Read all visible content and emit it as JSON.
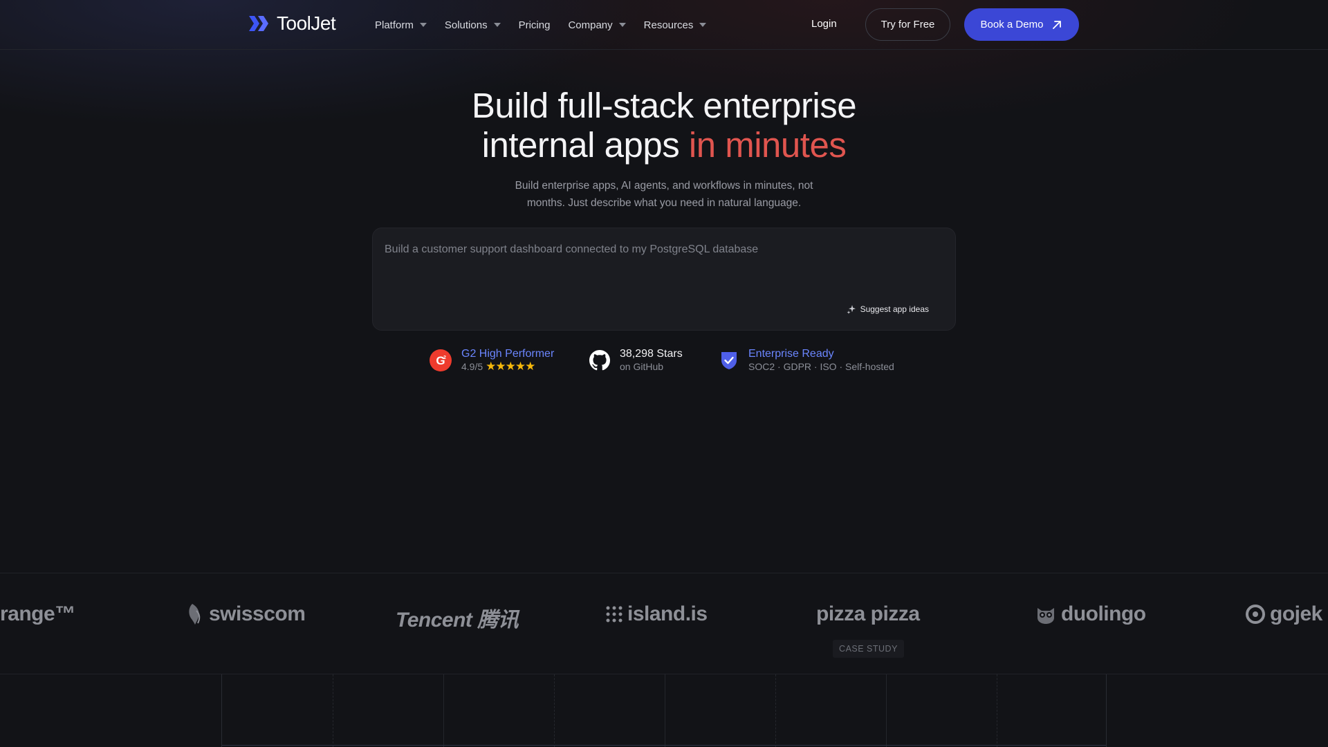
{
  "nav": {
    "brand": "ToolJet",
    "items": [
      {
        "label": "Platform",
        "dropdown": true
      },
      {
        "label": "Solutions",
        "dropdown": true
      },
      {
        "label": "Pricing",
        "dropdown": false
      },
      {
        "label": "Company",
        "dropdown": true
      },
      {
        "label": "Resources",
        "dropdown": true
      }
    ],
    "login": "Login",
    "try_free": "Try for Free",
    "book_demo": "Book a Demo"
  },
  "hero": {
    "title_line1": "Build full-stack enterprise",
    "title_line2_plain": "internal apps ",
    "title_line2_accent": "in minutes",
    "subtitle_line1": "Build enterprise apps, AI agents, and workflows in minutes, not",
    "subtitle_line2": "months. Just describe what you need in natural language."
  },
  "prompt": {
    "placeholder": "Build a customer support dashboard connected to my PostgreSQL database",
    "suggest_label": "Suggest app ideas"
  },
  "badges": {
    "g2": {
      "title": "G2 High Performer",
      "rating": "4.9/5",
      "stars": "★★★★★"
    },
    "github": {
      "title": "38,298 Stars",
      "sub": "on GitHub"
    },
    "enterprise": {
      "title": "Enterprise Ready",
      "sub": "SOC2 · GDPR · ISO · Self-hosted"
    }
  },
  "logos": {
    "items": [
      "range™",
      "swisscom",
      "Tencent 腾讯",
      "island.is",
      "pizza pizza",
      "duolingo",
      "gojek"
    ],
    "case_study": "CASE STUDY"
  },
  "colors": {
    "background": "#121317",
    "accent_red": "#e0554f",
    "primary_blue": "#3b47d6",
    "link_blue": "#6b86ff",
    "star_yellow": "#f5b80b"
  }
}
